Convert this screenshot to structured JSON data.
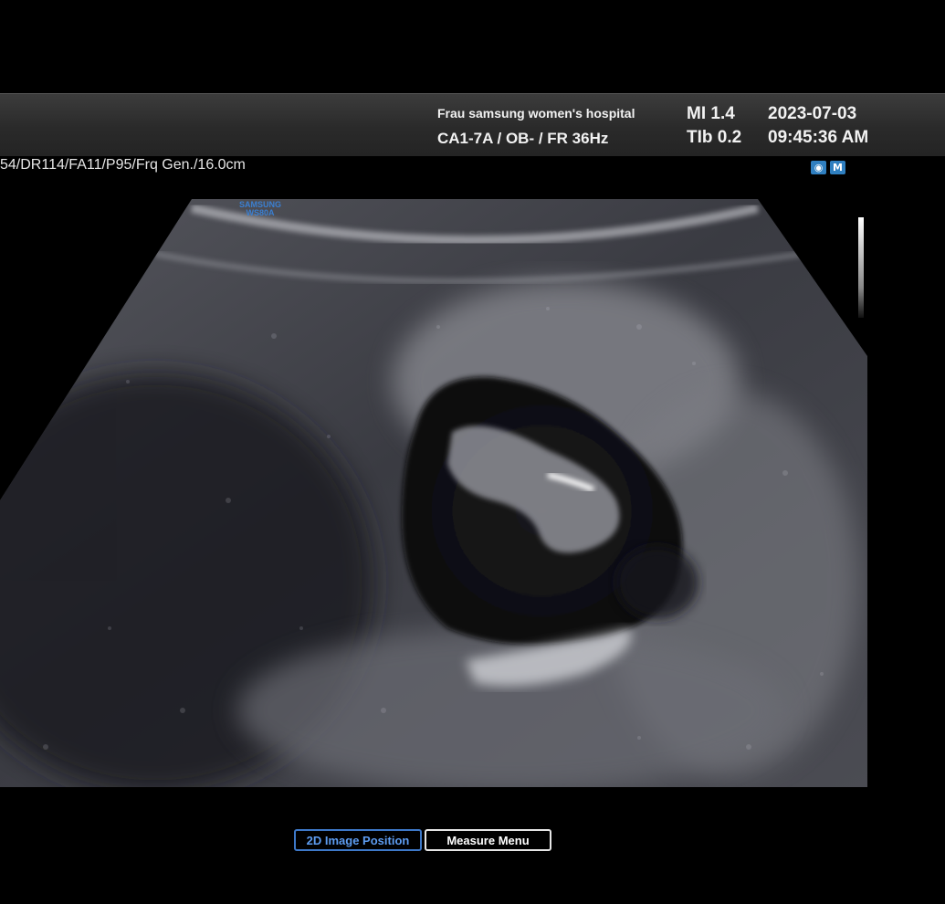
{
  "header": {
    "hospital": "Frau samsung women's hospital",
    "probe_line": "CA1-7A / OB- / FR 36Hz",
    "mi": "MI  1.4",
    "tib": "TIb 0.2",
    "date": "2023-07-03",
    "time": "09:45:36 AM"
  },
  "params_line": "54/DR114/FA11/P95/Frq Gen./16.0cm",
  "status_icons": [
    "eye-icon",
    "m-icon"
  ],
  "status_icon_glyphs": {
    "eye": "◉",
    "m": "M"
  },
  "watermark": {
    "line1": "SAMSUNG",
    "line2": "WS80A"
  },
  "buttons": {
    "image_position": "2D Image Position",
    "measure_menu": "Measure Menu"
  },
  "colors": {
    "accent_blue": "#3d78c8",
    "header_bg": "#2a2a2a"
  }
}
